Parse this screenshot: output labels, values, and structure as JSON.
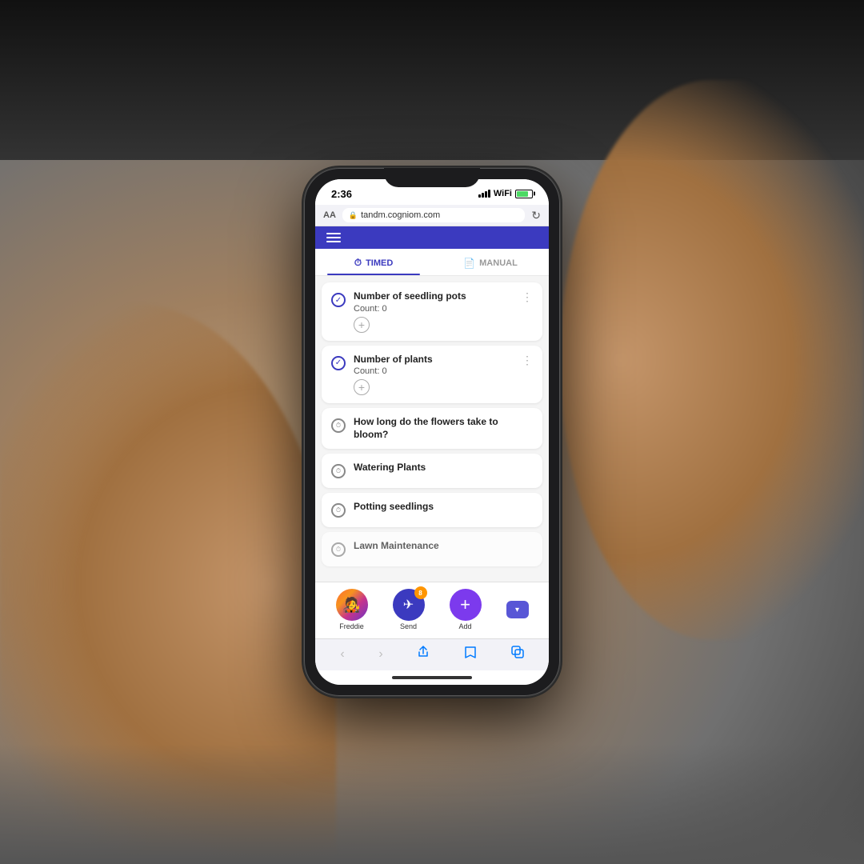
{
  "background": {
    "description": "hands holding phone on blurred background"
  },
  "phone": {
    "status_bar": {
      "time": "2:36",
      "signal": "signal",
      "wifi": "wifi",
      "battery": "battery"
    },
    "browser_bar": {
      "aa_label": "AA",
      "url": "tandm.cogniom.com",
      "lock_symbol": "🔒"
    },
    "tabs": [
      {
        "id": "timed",
        "label": "TIMED",
        "icon": "timer",
        "active": true
      },
      {
        "id": "manual",
        "label": "MANUAL",
        "icon": "document",
        "active": false
      }
    ],
    "tasks": [
      {
        "id": "task-1",
        "title": "Number of seedling pots",
        "subtitle": "Count: 0",
        "icon_type": "check",
        "has_add": true,
        "has_more": true
      },
      {
        "id": "task-2",
        "title": "Number of plants",
        "subtitle": "Count: 0",
        "icon_type": "check",
        "has_add": true,
        "has_more": true
      },
      {
        "id": "task-3",
        "title": "How long do the flowers take to bloom?",
        "subtitle": "",
        "icon_type": "timer",
        "has_add": false,
        "has_more": false
      },
      {
        "id": "task-4",
        "title": "Watering Plants",
        "subtitle": "",
        "icon_type": "timer",
        "has_add": false,
        "has_more": false
      },
      {
        "id": "task-5",
        "title": "Potting seedlings",
        "subtitle": "",
        "icon_type": "timer",
        "has_add": false,
        "has_more": false
      },
      {
        "id": "task-6",
        "title": "Lawn Maintenance",
        "subtitle": "",
        "icon_type": "timer",
        "has_add": false,
        "has_more": false,
        "partial": true
      }
    ],
    "toolbar": {
      "avatar_label": "Freddie",
      "send_label": "Send",
      "send_badge": "8",
      "add_label": "Add",
      "add_symbol": "+",
      "chevron": "▾"
    },
    "safari_nav": {
      "back": "‹",
      "forward": "›",
      "share": "⬆",
      "bookmarks": "📖",
      "tabs": "⧉"
    },
    "home_indicator": true
  }
}
